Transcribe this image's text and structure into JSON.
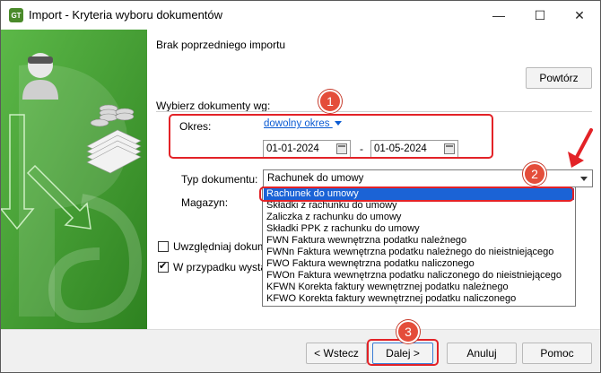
{
  "window": {
    "app_icon_text": "GT",
    "title": "Import - Kryteria wyboru dokumentów",
    "minimize": "—",
    "maximize": "☐",
    "close": "✕"
  },
  "previous_import": "Brak poprzedniego importu",
  "repeat_button": "Powtórz",
  "choose_by": "Wybierz dokumenty wg:",
  "period": {
    "label": "Okres:",
    "mode_link": "dowolny okres",
    "date_from": "01-01-2024",
    "separator": "-",
    "date_to": "01-05-2024"
  },
  "document_type": {
    "label": "Typ dokumentu:",
    "selected": "Rachunek do umowy",
    "options": [
      "Rachunek do umowy",
      "Składki z rachunku do umowy",
      "Zaliczka z rachunku do umowy",
      "Składki PPK z rachunku do umowy",
      "FWN Faktura wewnętrzna podatku należnego",
      "FWNn Faktura wewnętrzna podatku należnego do nieistniejącego",
      "FWO Faktura wewnętrzna podatku naliczonego",
      "FWOn Faktura wewnętrzna podatku naliczonego do nieistniejącego",
      "KFWN Korekta faktury wewnętrznej podatku należnego",
      "KFWO Korekta faktury wewnętrznej podatku naliczonego"
    ]
  },
  "warehouse_label": "Magazyn:",
  "checkbox_1": {
    "label": "Uwzględniaj dokumer",
    "checked": false
  },
  "checkbox_2": {
    "label": "W przypadku wystąpi",
    "checked": true
  },
  "buttons": {
    "back": "< Wstecz",
    "next": "Dalej >",
    "cancel": "Anuluj",
    "help": "Pomoc"
  },
  "annotations": {
    "badge_1": "1",
    "badge_2": "2",
    "badge_3": "3",
    "colors": {
      "annotation": "#e32227",
      "badge": "#e44d3a",
      "selection": "#1b63d6",
      "link": "#0b5bd3"
    }
  }
}
